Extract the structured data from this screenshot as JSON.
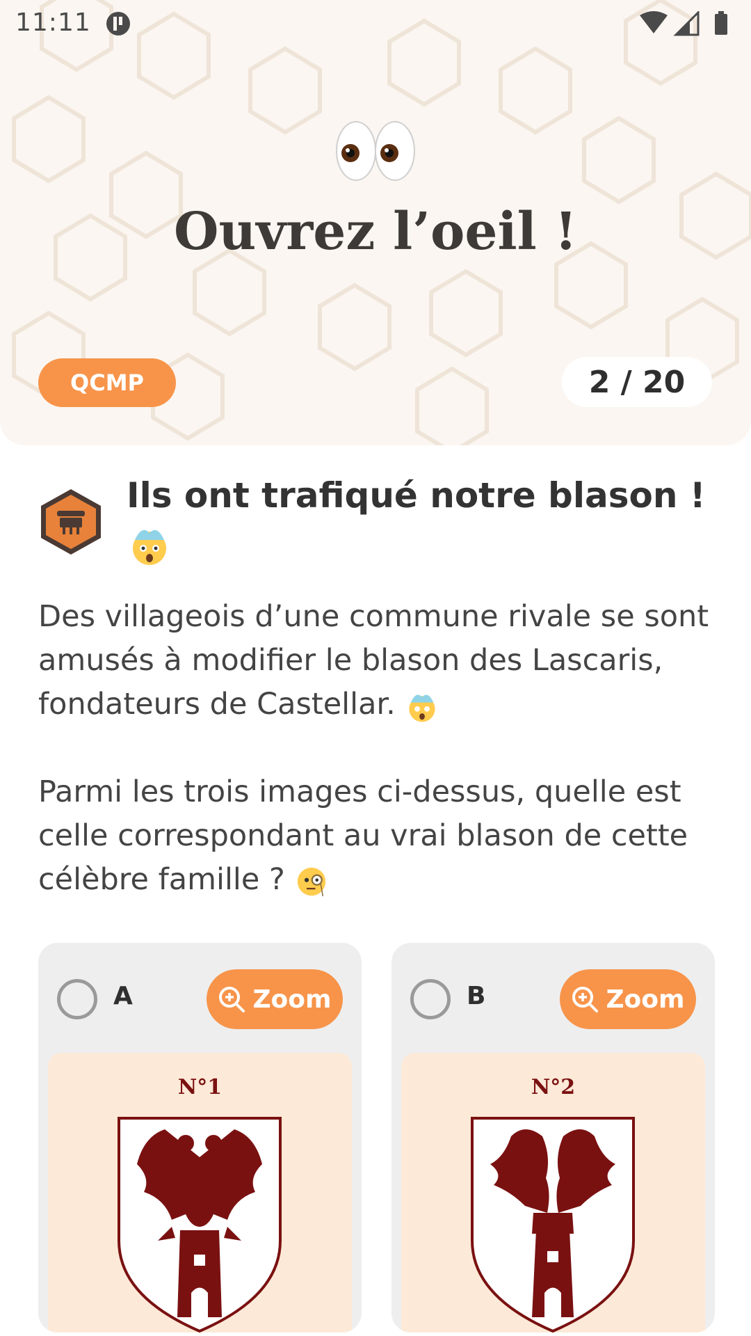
{
  "status_bar": {
    "time": "11:11"
  },
  "hero": {
    "title": "Ouvrez l’oeil !",
    "tag": "QCMP",
    "progress": "2 / 20"
  },
  "question": {
    "title": "Ils ont trafiqué notre blason !",
    "paragraph_1": "Des villageois d’une commune rivale se sont amusés à modifier le blason des Lascaris, fondateurs de Castellar.",
    "paragraph_2": "Parmi les trois images ci-dessus, quelle est celle correspondant au vrai blason de cette célèbre famille ?"
  },
  "options": [
    {
      "letter": "A",
      "zoom_label": "Zoom",
      "crest_label": "N°1",
      "crest_icon": "eagle-tower-crest"
    },
    {
      "letter": "B",
      "zoom_label": "Zoom",
      "crest_label": "N°2",
      "crest_icon": "lions-tower-crest"
    }
  ],
  "colors": {
    "accent": "#f7944a",
    "hero_bg": "#fbf6f1",
    "crest_red": "#7a1111",
    "crest_bg": "#fde9d7"
  }
}
